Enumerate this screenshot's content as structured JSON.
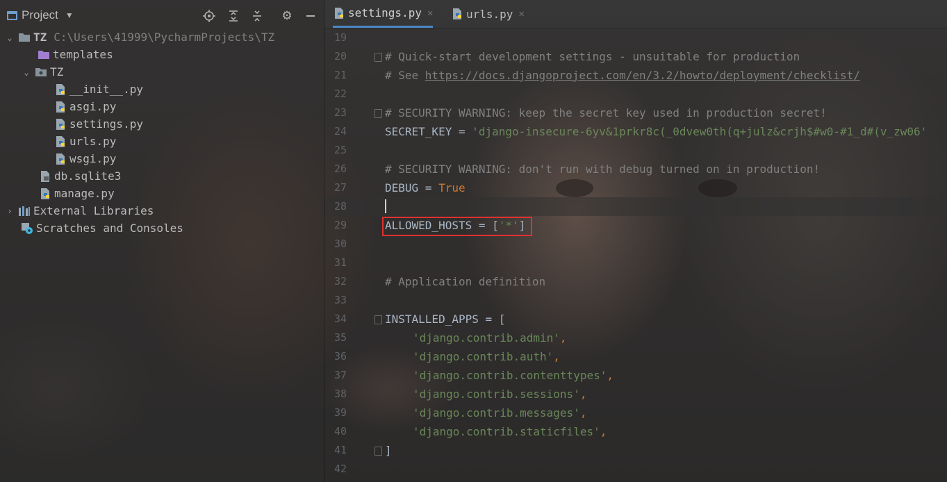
{
  "project_panel": {
    "title": "Project",
    "tree": [
      {
        "label": "TZ",
        "hint": "C:\\Users\\41999\\PycharmProjects\\TZ",
        "icon": "folder-icon"
      },
      {
        "label": "templates",
        "icon": "folder-icon"
      },
      {
        "label": "TZ",
        "icon": "package-folder-icon"
      },
      {
        "label": "__init__.py",
        "icon": "python-file-icon"
      },
      {
        "label": "asgi.py",
        "icon": "python-file-icon"
      },
      {
        "label": "settings.py",
        "icon": "python-file-icon"
      },
      {
        "label": "urls.py",
        "icon": "python-file-icon"
      },
      {
        "label": "wsgi.py",
        "icon": "python-file-icon"
      },
      {
        "label": "db.sqlite3",
        "icon": "database-file-icon"
      },
      {
        "label": "manage.py",
        "icon": "python-file-icon"
      },
      {
        "label": "External Libraries",
        "icon": "libraries-icon"
      },
      {
        "label": "Scratches and Consoles",
        "icon": "scratches-icon"
      }
    ]
  },
  "tabs": [
    {
      "label": "settings.py",
      "active": true
    },
    {
      "label": "urls.py",
      "active": false
    }
  ],
  "editor": {
    "lines": [
      {
        "num": "19",
        "text": ""
      },
      {
        "num": "20",
        "comment": "# Quick-start development settings - unsuitable for production"
      },
      {
        "num": "21",
        "comment": "# See ",
        "link": "https://docs.djangoproject.com/en/3.2/howto/deployment/checklist/"
      },
      {
        "num": "22",
        "text": ""
      },
      {
        "num": "23",
        "comment": "# SECURITY WARNING: keep the secret key used in production secret!"
      },
      {
        "num": "24",
        "name": "SECRET_KEY",
        "op": " = ",
        "str": "'django-insecure-6yv&1prkr8c(_0dvew0th(q+julz&crjh$#w0-#1_d#(v_zw06'"
      },
      {
        "num": "25",
        "text": ""
      },
      {
        "num": "26",
        "comment": "# SECURITY WARNING: don't run with debug turned on in production!"
      },
      {
        "num": "27",
        "name": "DEBUG",
        "op": " = ",
        "kw": "True"
      },
      {
        "num": "28",
        "text": ""
      },
      {
        "num": "29",
        "name": "ALLOWED_HOSTS",
        "op": " = [",
        "str": "'*'",
        "tail": "]"
      },
      {
        "num": "30",
        "text": ""
      },
      {
        "num": "31",
        "text": ""
      },
      {
        "num": "32",
        "comment": "# Application definition"
      },
      {
        "num": "33",
        "text": ""
      },
      {
        "num": "34",
        "text": "INSTALLED_APPS = ["
      },
      {
        "num": "35",
        "str": "'django.contrib.admin'",
        "tail": ","
      },
      {
        "num": "36",
        "str": "'django.contrib.auth'",
        "tail": ","
      },
      {
        "num": "37",
        "str": "'django.contrib.contenttypes'",
        "tail": ","
      },
      {
        "num": "38",
        "str": "'django.contrib.sessions'",
        "tail": ","
      },
      {
        "num": "39",
        "str": "'django.contrib.messages'",
        "tail": ","
      },
      {
        "num": "40",
        "str": "'django.contrib.staticfiles'",
        "tail": ","
      },
      {
        "num": "41",
        "text": "]"
      },
      {
        "num": "42",
        "text": ""
      }
    ]
  },
  "colors": {
    "comment": "#808080",
    "string": "#6a8759",
    "keyword": "#cc7832",
    "identifier": "#a9b7c6",
    "highlight_box": "#e03030",
    "active_tab_underline": "#4a88c7"
  }
}
